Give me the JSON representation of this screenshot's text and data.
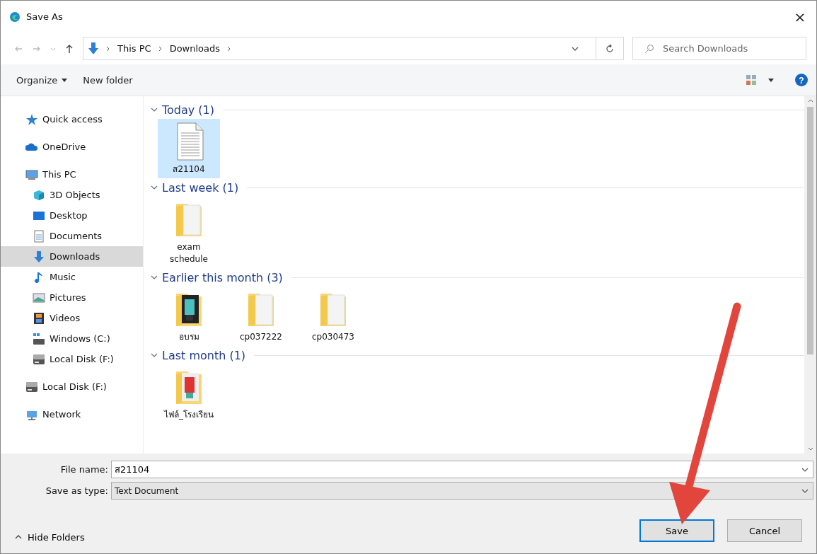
{
  "window": {
    "title": "Save As",
    "close": "×"
  },
  "address": {
    "path": [
      {
        "label": "This PC"
      },
      {
        "label": "Downloads"
      }
    ],
    "search_placeholder": "Search Downloads"
  },
  "toolbar": {
    "organize": "Organize",
    "new_folder": "New folder",
    "help": "?"
  },
  "sidebar": {
    "items": [
      {
        "label": "Quick access",
        "selected": false
      },
      {
        "label": "OneDrive",
        "selected": false
      },
      {
        "label": "This PC",
        "selected": false,
        "children": [
          {
            "label": "3D Objects",
            "selected": false
          },
          {
            "label": "Desktop",
            "selected": false
          },
          {
            "label": "Documents",
            "selected": false
          },
          {
            "label": "Downloads",
            "selected": true
          },
          {
            "label": "Music",
            "selected": false
          },
          {
            "label": "Pictures",
            "selected": false
          },
          {
            "label": "Videos",
            "selected": false
          },
          {
            "label": "Windows (C:)",
            "selected": false
          },
          {
            "label": "Local Disk (F:)",
            "selected": false
          }
        ]
      },
      {
        "label": "Local Disk (F:)",
        "selected": false
      },
      {
        "label": "Network",
        "selected": false
      }
    ]
  },
  "groups": [
    {
      "title": "Today (1)",
      "expanded": true,
      "items": [
        {
          "name": "ส21104",
          "kind": "document",
          "selected": true
        }
      ]
    },
    {
      "title": "Last week (1)",
      "expanded": true,
      "items": [
        {
          "name": "exam schedule",
          "kind": "folder",
          "selected": false
        }
      ]
    },
    {
      "title": "Earlier this month (3)",
      "expanded": true,
      "items": [
        {
          "name": "อบรม",
          "kind": "photo-folder",
          "selected": false
        },
        {
          "name": "cp037222",
          "kind": "folder",
          "selected": false
        },
        {
          "name": "cp030473",
          "kind": "folder",
          "selected": false
        }
      ]
    },
    {
      "title": "Last month (1)",
      "expanded": true,
      "items": [
        {
          "name": "ไฟล์_โรงเรียน",
          "kind": "photo-folder",
          "selected": false
        }
      ]
    }
  ],
  "form": {
    "file_name_label": "File name:",
    "file_name": "ส21104",
    "type_label": "Save as type:",
    "type": "Text Document"
  },
  "footer": {
    "hide_folders": "Hide Folders",
    "buttons": [
      {
        "label": "Save",
        "selected": true
      },
      {
        "label": "Cancel",
        "selected": false
      }
    ]
  }
}
